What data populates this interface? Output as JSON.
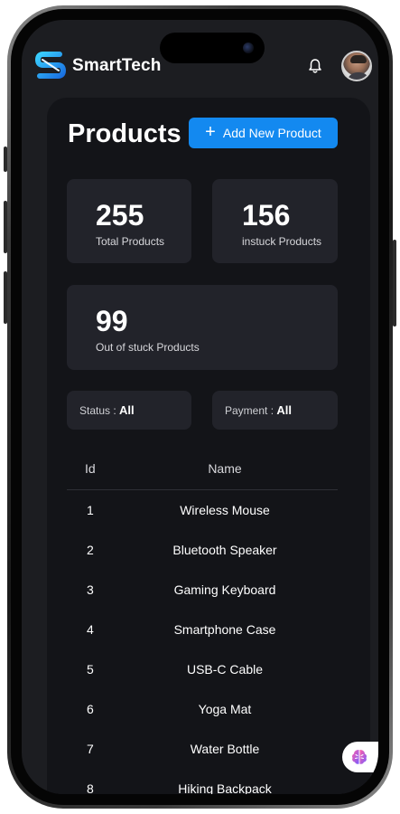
{
  "app": {
    "brand": "SmartTech"
  },
  "page": {
    "title": "Products",
    "add_button_label": "Add New Product"
  },
  "stats": [
    {
      "value": "255",
      "label": "Total Products"
    },
    {
      "value": "156",
      "label": "instuck Products"
    },
    {
      "value": "99",
      "label": "Out of stuck Products"
    }
  ],
  "filters": {
    "status": {
      "label": "Status :",
      "value": "All"
    },
    "payment": {
      "label": "Payment :",
      "value": "All"
    }
  },
  "table": {
    "headers": {
      "id": "Id",
      "name": "Name"
    },
    "rows": [
      {
        "id": "1",
        "name": "Wireless Mouse"
      },
      {
        "id": "2",
        "name": "Bluetooth Speaker"
      },
      {
        "id": "3",
        "name": "Gaming Keyboard"
      },
      {
        "id": "4",
        "name": "Smartphone Case"
      },
      {
        "id": "5",
        "name": "USB-C Cable"
      },
      {
        "id": "6",
        "name": "Yoga Mat"
      },
      {
        "id": "7",
        "name": "Water Bottle"
      },
      {
        "id": "8",
        "name": "Hiking Backpack"
      }
    ]
  },
  "icons": {
    "logo": "smarttech-logo-icon",
    "notifications": "bell-icon",
    "add": "plus-icon",
    "assistant": "brain-assistant-icon"
  },
  "colors": {
    "accent": "#1389f0",
    "background": "#1c1d21",
    "panel": "#131418",
    "card": "#22232a"
  }
}
